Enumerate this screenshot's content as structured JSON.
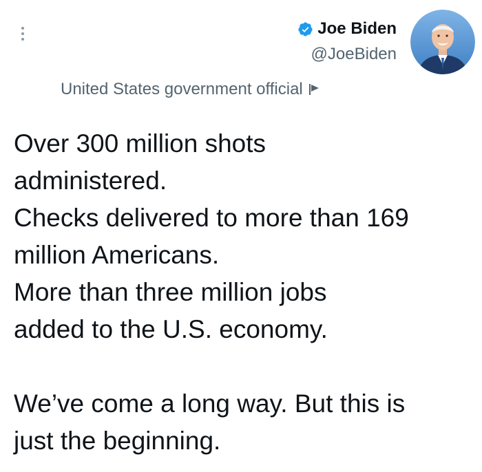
{
  "author": {
    "display_name": "Joe Biden",
    "handle": "@JoeBiden",
    "verified": true,
    "avatar_icon": "profile-photo"
  },
  "affiliation": {
    "label": "United States government official",
    "icon": "flag-icon"
  },
  "tweet": {
    "lines": [
      "Over 300 million shots",
      "administered.",
      "Checks delivered to more than 169",
      "million Americans.",
      "More than three million jobs",
      "added to the U.S. economy.",
      "We’ve come a long way. But this is",
      "just the beginning."
    ]
  },
  "colors": {
    "text": "#0f1419",
    "secondary_text": "#536471",
    "verified_badge": "#1d9bf0",
    "menu_dots": "#8b98a5"
  }
}
